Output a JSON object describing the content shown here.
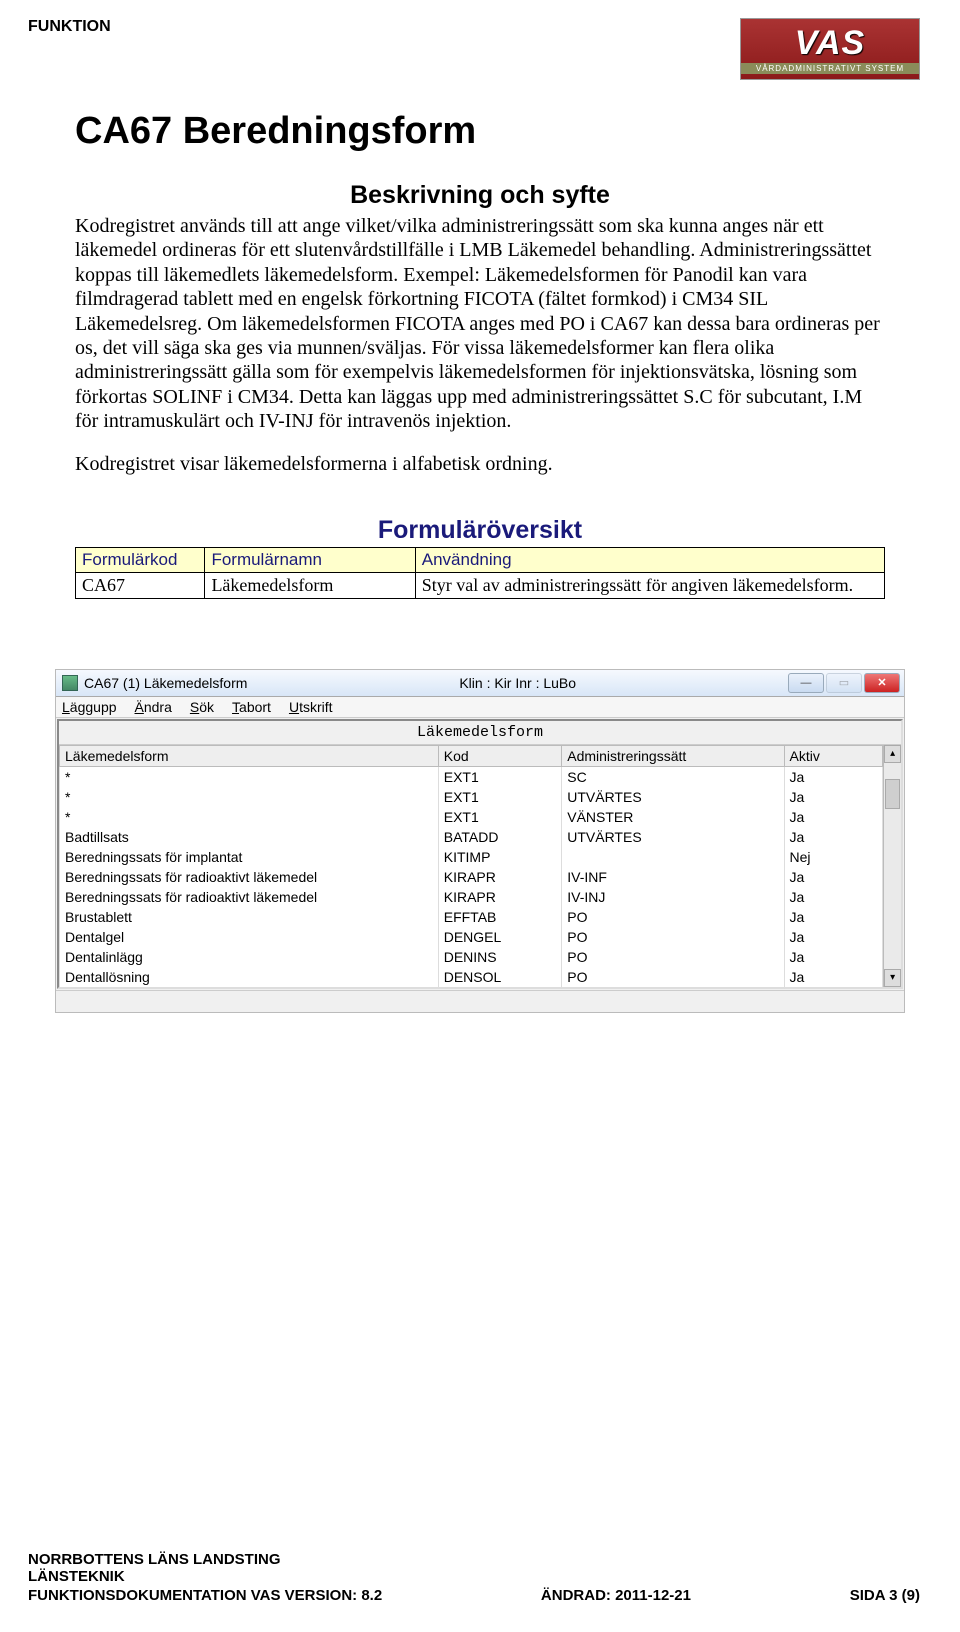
{
  "header": {
    "funktion": "FUNKTION",
    "logo_main": "VAS",
    "logo_sub": "VÅRDADMINISTRATIVT SYSTEM"
  },
  "title": "CA67 Beredningsform",
  "subtitle": "Beskrivning och syfte",
  "paragraph1": "Kodregistret används till att ange vilket/vilka administreringssätt som ska kunna anges när ett läkemedel ordineras för ett slutenvårdstillfälle i LMB Läkemedel behandling. Administreringssättet koppas till läkemedlets läkemedelsform. Exempel: Läkemedelsformen för Panodil kan vara filmdragerad tablett med en engelsk förkortning FICOTA (fältet formkod) i CM34 SIL Läkemedelsreg. Om läkemedelsformen FICOTA anges med PO i CA67 kan dessa bara ordineras per os, det vill säga ska ges via munnen/sväljas. För vissa läkemedelsformer kan flera olika administreringssätt gälla som för exempelvis läkemedelsformen för injektionsvätska, lösning som förkortas SOLINF i CM34. Detta kan läggas upp med administreringssättet S.C för subcutant, I.M för intramuskulärt och IV-INJ för intravenös injektion.",
  "paragraph2": "Kodregistret visar läkemedelsformerna i alfabetisk ordning.",
  "overview_heading": "Formuläröversikt",
  "overview_table": {
    "headers": {
      "col1": "Formulärkod",
      "col2": "Formulärnamn",
      "col3": "Användning"
    },
    "row": {
      "col1": "CA67",
      "col2": "Läkemedelsform",
      "col3": "Styr val av administreringssätt för angiven läkemedelsform."
    }
  },
  "window": {
    "title": "CA67 (1) Läkemedelsform",
    "info": "Klin : Kir  Inr : LuBo",
    "menu": {
      "m1": "Läggupp",
      "m2": "Ändra",
      "m3": "Sök",
      "m4": "Tabort",
      "m5": "Utskrift"
    },
    "panel_title": "Läkemedelsform",
    "columns": {
      "c1": "Läkemedelsform",
      "c2": "Kod",
      "c3": "Administreringssätt",
      "c4": "Aktiv"
    },
    "rows": [
      {
        "c1": "*",
        "c2": "EXT1",
        "c3": "SC",
        "c4": "Ja"
      },
      {
        "c1": "*",
        "c2": "EXT1",
        "c3": "UTVÄRTES",
        "c4": "Ja"
      },
      {
        "c1": "*",
        "c2": "EXT1",
        "c3": "VÄNSTER",
        "c4": "Ja"
      },
      {
        "c1": "Badtillsats",
        "c2": "BATADD",
        "c3": "UTVÄRTES",
        "c4": "Ja"
      },
      {
        "c1": "Beredningssats för implantat",
        "c2": "KITIMP",
        "c3": "",
        "c4": "Nej"
      },
      {
        "c1": "Beredningssats för radioaktivt läkemedel",
        "c2": "KIRAPR",
        "c3": "IV-INF",
        "c4": "Ja"
      },
      {
        "c1": "Beredningssats för radioaktivt läkemedel",
        "c2": "KIRAPR",
        "c3": "IV-INJ",
        "c4": "Ja"
      },
      {
        "c1": "Brustablett",
        "c2": "EFFTAB",
        "c3": "PO",
        "c4": "Ja"
      },
      {
        "c1": "Dentalgel",
        "c2": "DENGEL",
        "c3": "PO",
        "c4": "Ja"
      },
      {
        "c1": "Dentalinlägg",
        "c2": "DENINS",
        "c3": "PO",
        "c4": "Ja"
      },
      {
        "c1": "Dentallösning",
        "c2": "DENSOL",
        "c3": "PO",
        "c4": "Ja"
      }
    ]
  },
  "footer": {
    "line1": "NORRBOTTENS LÄNS LANDSTING",
    "line2": "LÄNSTEKNIK",
    "doc": "FUNKTIONSDOKUMENTATION VAS VERSION: 8.2",
    "changed": "ÄNDRAD: 2011-12-21",
    "page": "SIDA 3 (9)"
  }
}
